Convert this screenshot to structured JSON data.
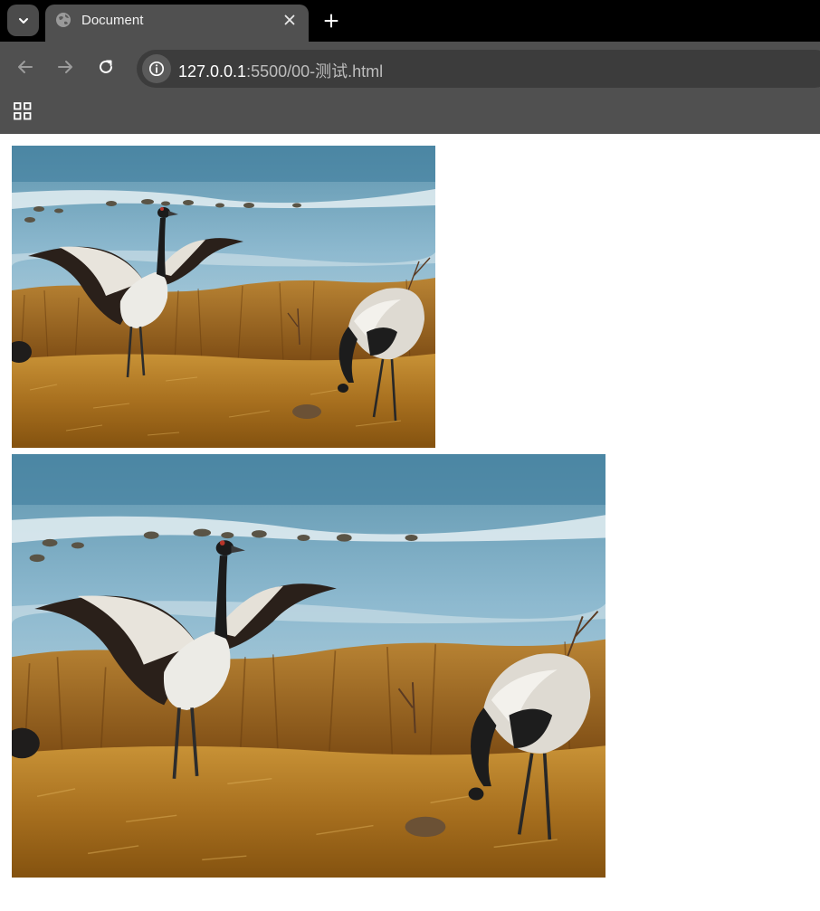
{
  "browser": {
    "tab_title": "Document",
    "url_host": "127.0.0.1",
    "url_rest": ":5500/00-测试.html"
  },
  "icons": {
    "tab_menu": "chevron-down-icon",
    "favicon": "globe-icon",
    "close_tab": "close-icon",
    "new_tab": "plus-icon",
    "back": "arrow-left-icon",
    "forward": "arrow-right-icon",
    "reload": "reload-icon",
    "site_info": "info-icon",
    "apps": "apps-grid-icon"
  },
  "page": {
    "images": [
      {
        "subject": "two black-necked cranes on grassland by a lake"
      },
      {
        "subject": "two black-necked cranes on grassland by a lake (larger)"
      }
    ]
  },
  "colors": {
    "tabstrip": "#000000",
    "toolbar": "#505050",
    "omnibox": "#3c3c3c"
  }
}
